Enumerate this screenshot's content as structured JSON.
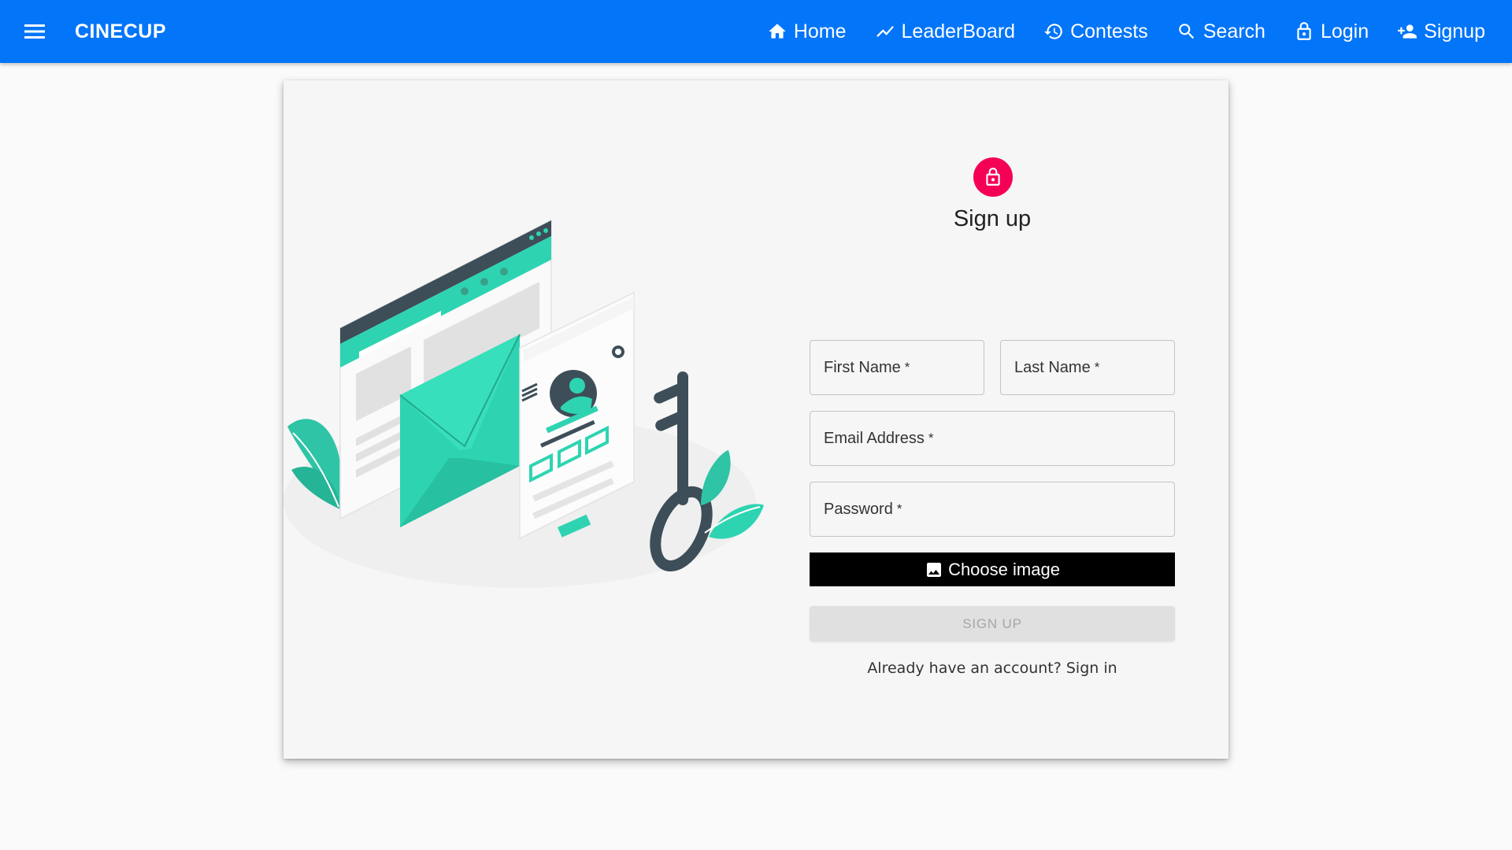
{
  "appbar": {
    "brand": "CINECUP",
    "color": "#0275f8",
    "nav": [
      {
        "label": "Home",
        "icon": "home-icon"
      },
      {
        "label": "LeaderBoard",
        "icon": "trending-icon"
      },
      {
        "label": "Contests",
        "icon": "history-icon"
      },
      {
        "label": "Search",
        "icon": "search-icon"
      },
      {
        "label": "Login",
        "icon": "lock-icon"
      },
      {
        "label": "Signup",
        "icon": "person-add-icon"
      }
    ]
  },
  "form": {
    "title": "Sign up",
    "avatar_color": "#f50057",
    "fields": {
      "first_name": "First Name",
      "last_name": "Last Name",
      "email": "Email Address",
      "password": "Password",
      "required_mark": "*"
    },
    "choose_image_label": "Choose image",
    "submit_label": "SIGN UP",
    "signin_link": "Already have an account? Sign in"
  }
}
